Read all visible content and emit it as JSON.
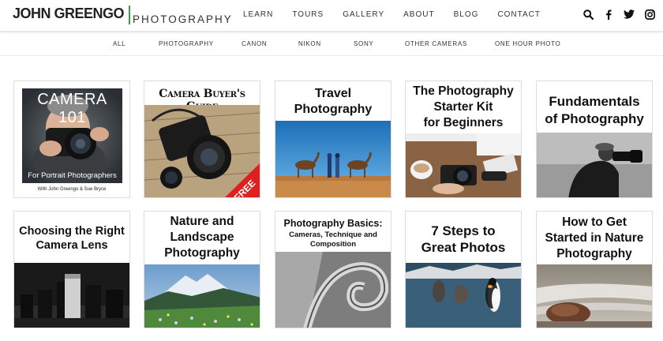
{
  "header": {
    "logo_name": "JOHN GREENGO",
    "logo_sub": "PHOTOGRAPHY",
    "nav": [
      "LEARN",
      "TOURS",
      "GALLERY",
      "ABOUT",
      "BLOG",
      "CONTACT"
    ],
    "icons": [
      "search-icon",
      "facebook-icon",
      "twitter-icon",
      "instagram-icon"
    ]
  },
  "subnav": [
    "ALL",
    "PHOTOGRAPHY",
    "CANON",
    "NIKON",
    "SONY",
    "OTHER CAMERAS",
    "ONE HOUR PHOTO"
  ],
  "cards": [
    {
      "title": "CAMERA 101",
      "subtitle": "For Portrait Photographers",
      "caption": "With John Greengo & Sue Bryce"
    },
    {
      "title": "Camera Buyer's Guide",
      "badge": "FREE"
    },
    {
      "title_lines": [
        "Travel",
        "Photography"
      ]
    },
    {
      "title_lines": [
        "The Photography",
        "Starter Kit",
        "for Beginners"
      ]
    },
    {
      "title_lines": [
        "Fundamentals",
        "of Photography"
      ]
    },
    {
      "title_lines": [
        "Choosing the Right",
        "Camera Lens"
      ]
    },
    {
      "title_lines": [
        "Nature and",
        "Landscape",
        "Photography"
      ]
    },
    {
      "title_lines": [
        "Photography Basics:",
        "Cameras, Technique and",
        "Composition"
      ]
    },
    {
      "title_lines": [
        "7 Steps to",
        "Great Photos"
      ]
    },
    {
      "title_lines": [
        "How to Get",
        "Started in Nature",
        "Photography"
      ]
    }
  ],
  "colors": {
    "accent": "#3aa04a",
    "free_badge": "#e02020"
  }
}
